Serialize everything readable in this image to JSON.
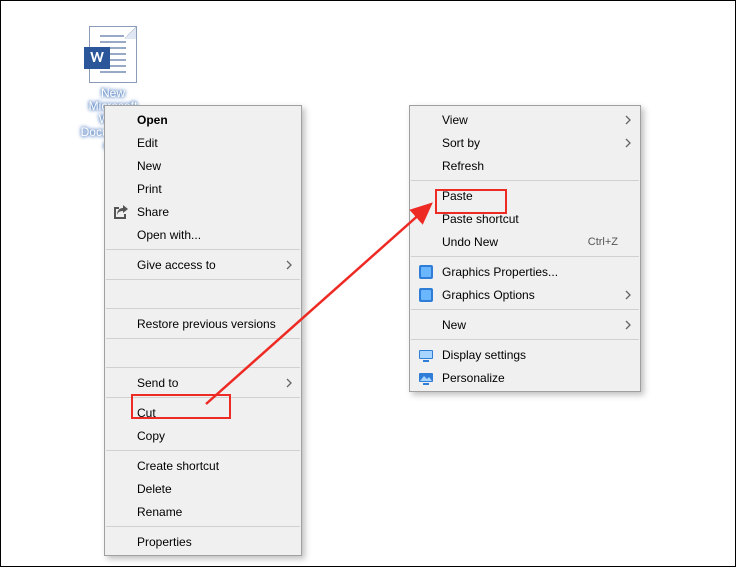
{
  "file": {
    "icon_letter": "W",
    "label": "New\nMicrosoft\nWord\nDocument.d\nocx"
  },
  "menu1": {
    "open": "Open",
    "edit": "Edit",
    "new": "New",
    "print": "Print",
    "share": "Share",
    "open_with": "Open with...",
    "give_access_to": "Give access to",
    "restore_previous_versions": "Restore previous versions",
    "send_to": "Send to",
    "cut": "Cut",
    "copy": "Copy",
    "create_shortcut": "Create shortcut",
    "delete": "Delete",
    "rename": "Rename",
    "properties": "Properties"
  },
  "menu2": {
    "view": "View",
    "sort_by": "Sort by",
    "refresh": "Refresh",
    "paste": "Paste",
    "paste_shortcut": "Paste shortcut",
    "undo_new": "Undo New",
    "undo_shortcut": "Ctrl+Z",
    "graphics_properties": "Graphics Properties...",
    "graphics_options": "Graphics Options",
    "new": "New",
    "display_settings": "Display settings",
    "personalize": "Personalize"
  },
  "annotations": {
    "cut_highlight": "cut",
    "paste_highlight": "paste",
    "arrow": "arrow-cut-to-paste"
  }
}
